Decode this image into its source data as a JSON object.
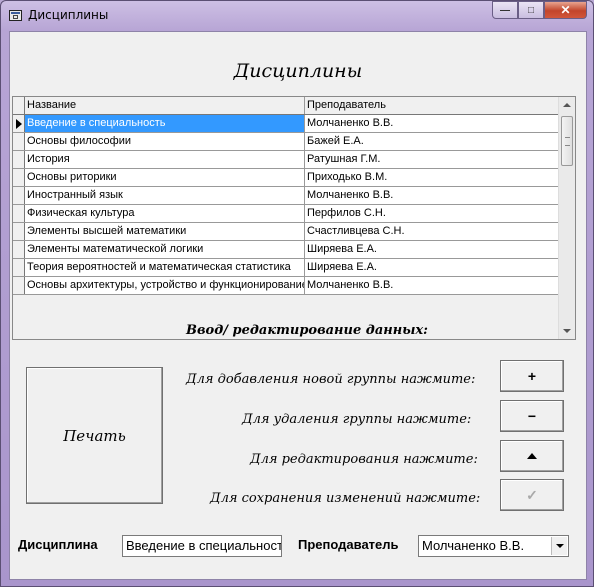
{
  "window": {
    "title": "Дисциплины",
    "min_label": "—",
    "max_label": "□",
    "close_label": "✕"
  },
  "heading": "Дисциплины",
  "grid": {
    "columns": [
      "Название",
      "Преподаватель"
    ],
    "rows": [
      {
        "name": "Введение в специальность",
        "teacher": "Молчаненко В.В."
      },
      {
        "name": "Основы философии",
        "teacher": "Бажей Е.А."
      },
      {
        "name": "История",
        "teacher": "Ратушная Г.М."
      },
      {
        "name": "Основы риторики",
        "teacher": "Приходько В.М."
      },
      {
        "name": "Иностранный язык",
        "teacher": "Молчаненко В.В."
      },
      {
        "name": "Физическая культура",
        "teacher": "Перфилов С.Н."
      },
      {
        "name": "Элементы высшей математики",
        "teacher": "Счастливцева С.Н."
      },
      {
        "name": "Элементы математической логики",
        "teacher": "Ширяева Е.А."
      },
      {
        "name": "Теория вероятностей и математическая статистика",
        "teacher": "Ширяева Е.А."
      },
      {
        "name": "Основы архитектуры, устройство и функционирование",
        "teacher": "Молчаненко В.В."
      }
    ],
    "selected_row": 0
  },
  "section_title": "Ввод/ редактирование данных:",
  "print_button": "Печать",
  "actions": [
    {
      "hint": "Для добавления новой группы нажмите:",
      "symbol": "+",
      "icon": "plus-icon"
    },
    {
      "hint": "Для удаления группы нажмите:",
      "symbol": "−",
      "icon": "minus-icon"
    },
    {
      "hint": "Для  редактирования нажмите:",
      "symbol": "",
      "icon": "triangle-up-icon"
    },
    {
      "hint": "Для сохранения изменений нажмите:",
      "symbol": "✓",
      "icon": "checkmark-icon"
    }
  ],
  "fields": {
    "discipline_label": "Дисциплина",
    "discipline_value": "Введение в специальность",
    "teacher_label": "Преподаватель",
    "teacher_value": "Молчаненко В.В."
  }
}
